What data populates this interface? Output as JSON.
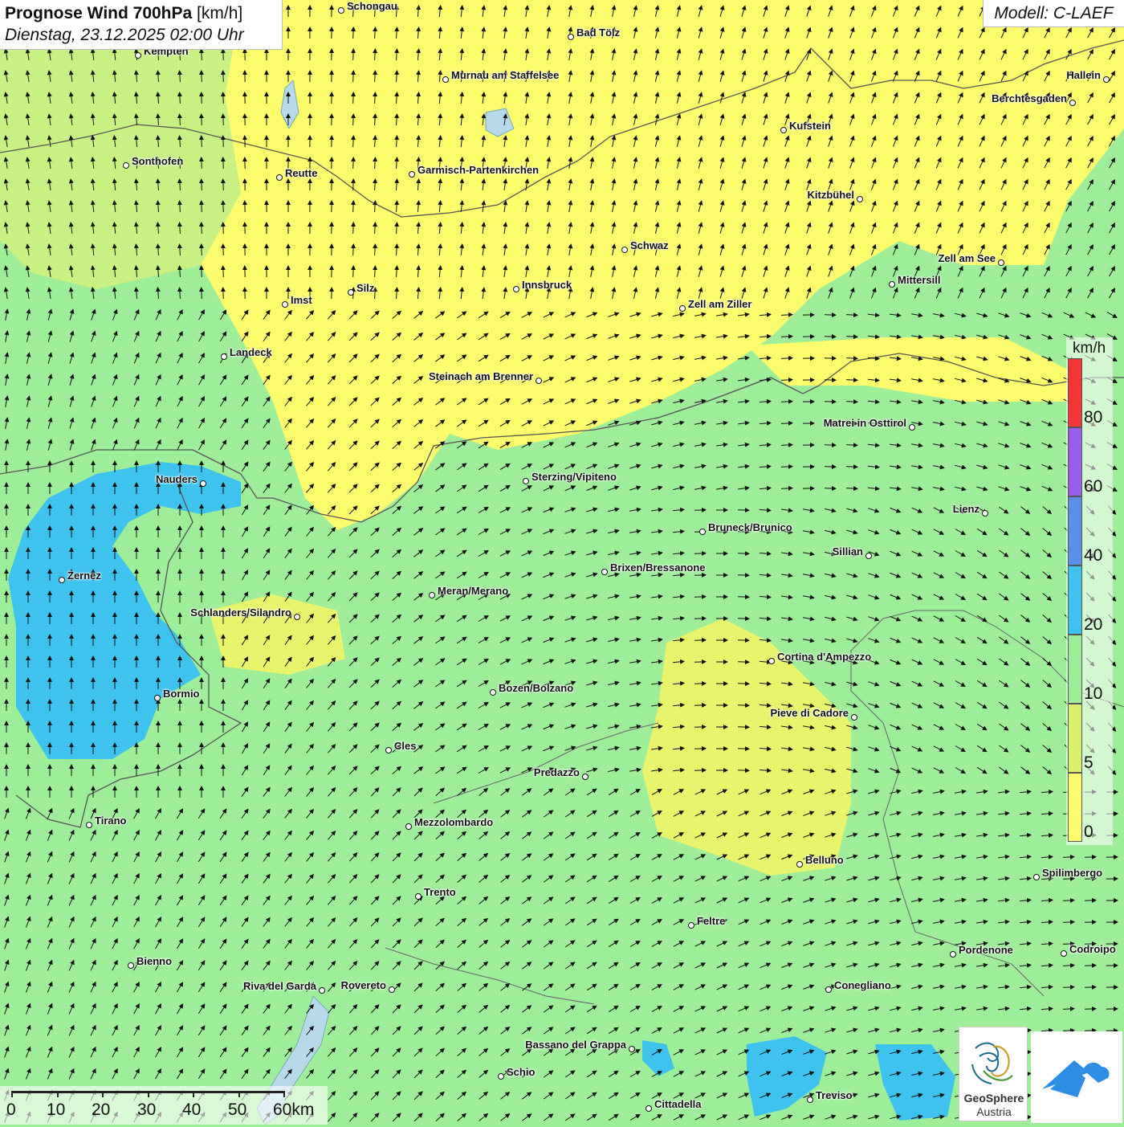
{
  "header": {
    "title_bold": "Prognose Wind 700hPa",
    "title_unit": "[km/h]",
    "datetime": "Dienstag, 23.12.2025 02:00 Uhr"
  },
  "model": "Modell: C-LAEF",
  "legend": {
    "unit": "km/h",
    "labels": [
      "80",
      "60",
      "40",
      "20",
      "10",
      "5",
      "0"
    ],
    "colors": {
      "0-5": "#fcfc6c",
      "5-10": "#d9f06a",
      "10-20": "#9ded99",
      "20-40": "#3ec3ef",
      "40-60": "#5c8fe8",
      "60-80": "#9a5fe8",
      "80+": "#f43535"
    }
  },
  "scale_bar": {
    "labels": [
      "0",
      "10",
      "20",
      "30",
      "40",
      "50",
      "60km"
    ]
  },
  "logos": {
    "geosphere_line1": "GeoSphere",
    "geosphere_line2": "Austria"
  },
  "places": [
    {
      "name": "Schongau"
    },
    {
      "name": "Bad Tölz"
    },
    {
      "name": "Kempten"
    },
    {
      "name": "Murnau am Staffelsee"
    },
    {
      "name": "Hallein"
    },
    {
      "name": "Berchtesgaden"
    },
    {
      "name": "Kufstein"
    },
    {
      "name": "Sonthofen"
    },
    {
      "name": "Reutte"
    },
    {
      "name": "Garmisch-Partenkirchen"
    },
    {
      "name": "Kitzbühel"
    },
    {
      "name": "Schwaz"
    },
    {
      "name": "Zell am See"
    },
    {
      "name": "Mittersill"
    },
    {
      "name": "Innsbruck"
    },
    {
      "name": "Silz"
    },
    {
      "name": "Imst"
    },
    {
      "name": "Zell am Ziller"
    },
    {
      "name": "Landeck"
    },
    {
      "name": "Steinach am Brenner"
    },
    {
      "name": "Matrei in Osttirol"
    },
    {
      "name": "Nauders"
    },
    {
      "name": "Sterzing/Vipiteno"
    },
    {
      "name": "Lienz"
    },
    {
      "name": "Bruneck/Brunico"
    },
    {
      "name": "Sillian"
    },
    {
      "name": "Brixen/Bressanone"
    },
    {
      "name": "Zernez"
    },
    {
      "name": "Meran/Merano"
    },
    {
      "name": "Schlanders/Silandro"
    },
    {
      "name": "Cortina d'Ampezzo"
    },
    {
      "name": "Bozen/Bolzano"
    },
    {
      "name": "Bormio"
    },
    {
      "name": "Pieve di Cadore"
    },
    {
      "name": "Cles"
    },
    {
      "name": "Predazzo"
    },
    {
      "name": "Tirano"
    },
    {
      "name": "Mezzolombardo"
    },
    {
      "name": "Belluno"
    },
    {
      "name": "Spilimbergo"
    },
    {
      "name": "Trento"
    },
    {
      "name": "Feltre"
    },
    {
      "name": "Pordenone"
    },
    {
      "name": "Codroipo"
    },
    {
      "name": "Bienno"
    },
    {
      "name": "Riva del Garda"
    },
    {
      "name": "Rovereto"
    },
    {
      "name": "Conegliano"
    },
    {
      "name": "Bassano del Grappa"
    },
    {
      "name": "Schio"
    },
    {
      "name": "Treviso"
    },
    {
      "name": "Cittadella"
    }
  ]
}
